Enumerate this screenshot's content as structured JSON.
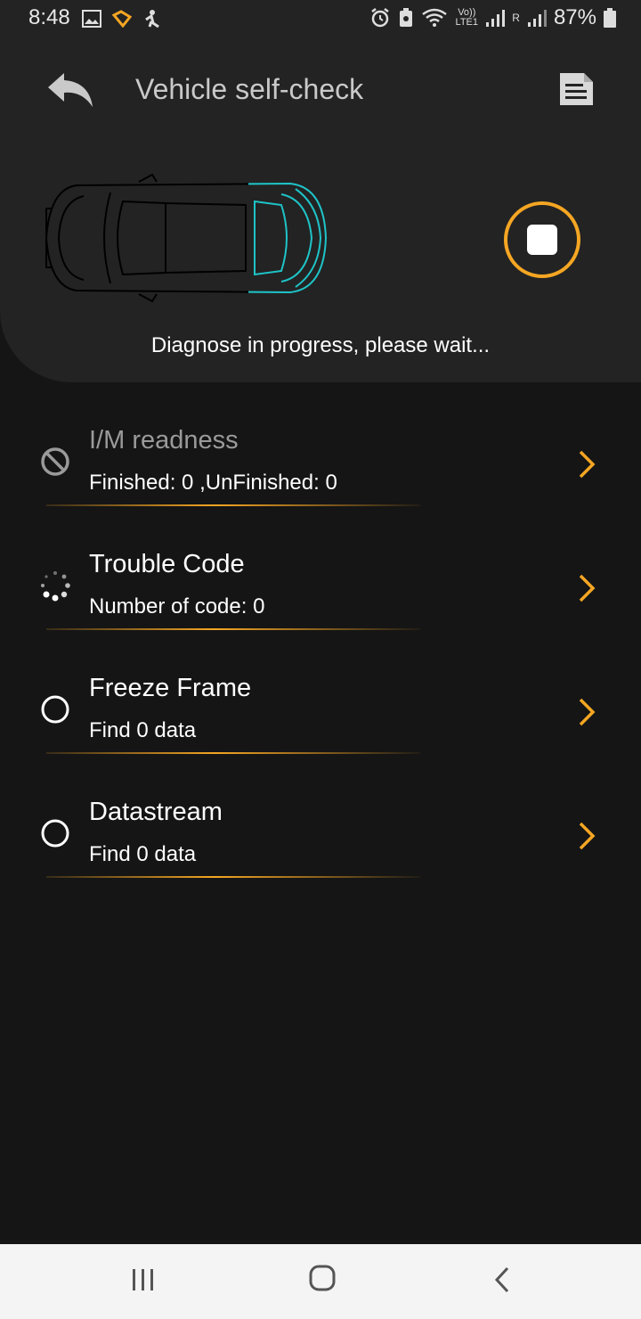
{
  "status_bar": {
    "time": "8:48",
    "battery": "87%",
    "network_label": "Vo)) LTE1",
    "roaming": "R",
    "icons": [
      "image-icon",
      "app-notification-icon",
      "accessibility-icon",
      "alarm-icon",
      "saver-icon",
      "wifi-icon",
      "signal-icon",
      "battery-icon"
    ]
  },
  "header": {
    "title": "Vehicle self-check",
    "progress_text": "Diagnose in progress, please wait...",
    "accent_color": "#f5a623",
    "scan_color": "#1ec4c8"
  },
  "items": [
    {
      "title": "I/M readness",
      "subtitle": "Finished: 0 ,UnFinished: 0",
      "state": "disabled"
    },
    {
      "title": "Trouble Code",
      "subtitle": "Number of code: 0",
      "state": "loading"
    },
    {
      "title": "Freeze Frame",
      "subtitle": "Find 0 data",
      "state": "pending"
    },
    {
      "title": "Datastream",
      "subtitle": "Find 0 data",
      "state": "pending"
    }
  ]
}
